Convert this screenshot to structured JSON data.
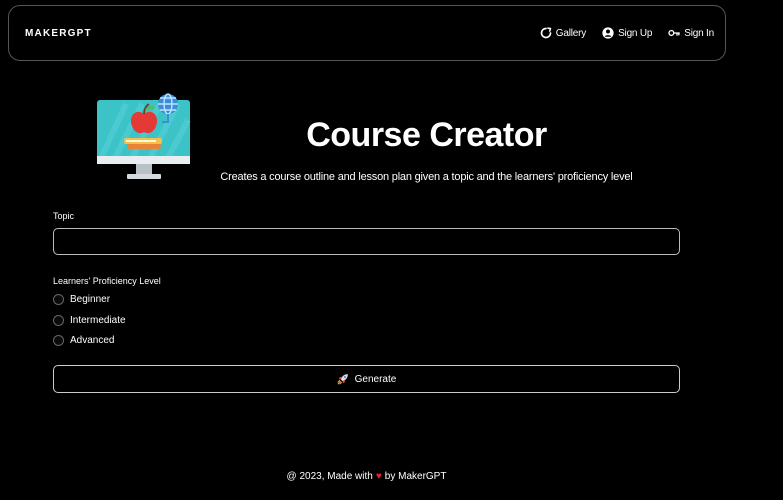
{
  "navbar": {
    "brand": "MAKERGPT",
    "links": [
      {
        "label": "Gallery",
        "icon": "refresh-icon"
      },
      {
        "label": "Sign Up",
        "icon": "user-icon"
      },
      {
        "label": "Sign In",
        "icon": "key-icon"
      }
    ]
  },
  "hero": {
    "icon": "computer-apple-icon",
    "title": "Course Creator",
    "subtitle": "Creates a course outline and lesson plan given a topic and the learners' proficiency level"
  },
  "form": {
    "topic_label": "Topic",
    "topic_value": "",
    "level_label": "Learners' Proficiency Level",
    "levels": [
      "Beginner",
      "Intermediate",
      "Advanced"
    ],
    "generate_label": "Generate",
    "generate_icon": "rocket-icon"
  },
  "footer": {
    "prefix": "@ 2023, Made with",
    "heart": "♥",
    "suffix": "by MakerGPT"
  },
  "colors": {
    "background": "#000000",
    "heart": "#e0232b",
    "monitor_screen": "#3cc3c8"
  }
}
